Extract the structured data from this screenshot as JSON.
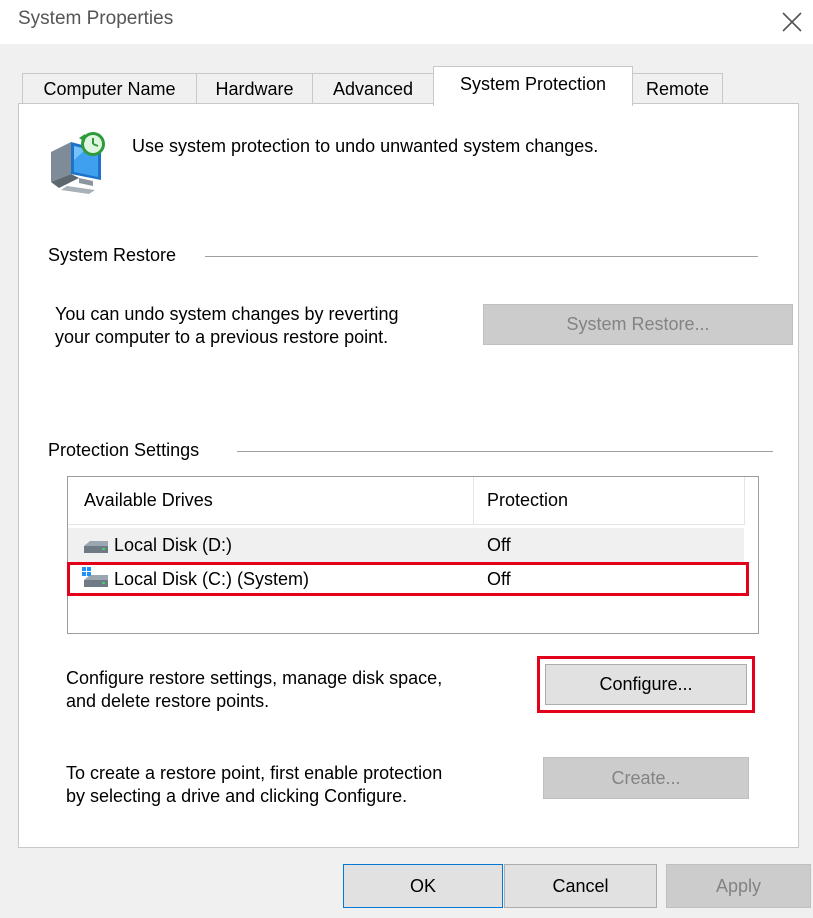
{
  "window": {
    "title": "System Properties",
    "close_glyph": "✕"
  },
  "tabs": [
    {
      "label": "Computer Name",
      "active": false
    },
    {
      "label": "Hardware",
      "active": false
    },
    {
      "label": "Advanced",
      "active": false
    },
    {
      "label": "System Protection",
      "active": true
    },
    {
      "label": "Remote",
      "active": false
    }
  ],
  "intro": {
    "icon": "system-protection-icon",
    "text": "Use system protection to undo unwanted system changes."
  },
  "system_restore": {
    "group_label": "System Restore",
    "description_line1": "You can undo system changes by reverting",
    "description_line2": "your computer to a previous restore point.",
    "button_label": "System Restore...",
    "button_enabled": false
  },
  "protection_settings": {
    "group_label": "Protection Settings",
    "columns": [
      "Available Drives",
      "Protection"
    ],
    "drives": [
      {
        "name": "Local Disk (D:)",
        "protection": "Off",
        "icon": "hard-drive-icon",
        "selected": true,
        "highlighted": false
      },
      {
        "name": "Local Disk (C:) (System)",
        "protection": "Off",
        "icon": "system-drive-icon",
        "selected": false,
        "highlighted": true
      }
    ],
    "configure_description_line1": "Configure restore settings, manage disk space,",
    "configure_description_line2": "and delete restore points.",
    "configure_button_label": "Configure...",
    "configure_highlighted": true,
    "create_description_line1": "To create a restore point, first enable protection",
    "create_description_line2": "by selecting a drive and clicking Configure.",
    "create_button_label": "Create...",
    "create_enabled": false
  },
  "dialog_buttons": {
    "ok": "OK",
    "cancel": "Cancel",
    "apply": "Apply",
    "apply_enabled": false
  },
  "colors": {
    "highlight": "#e3001b",
    "panel_bg": "#ffffff",
    "window_bg": "#f0f0f0",
    "disabled_text": "#838383"
  }
}
